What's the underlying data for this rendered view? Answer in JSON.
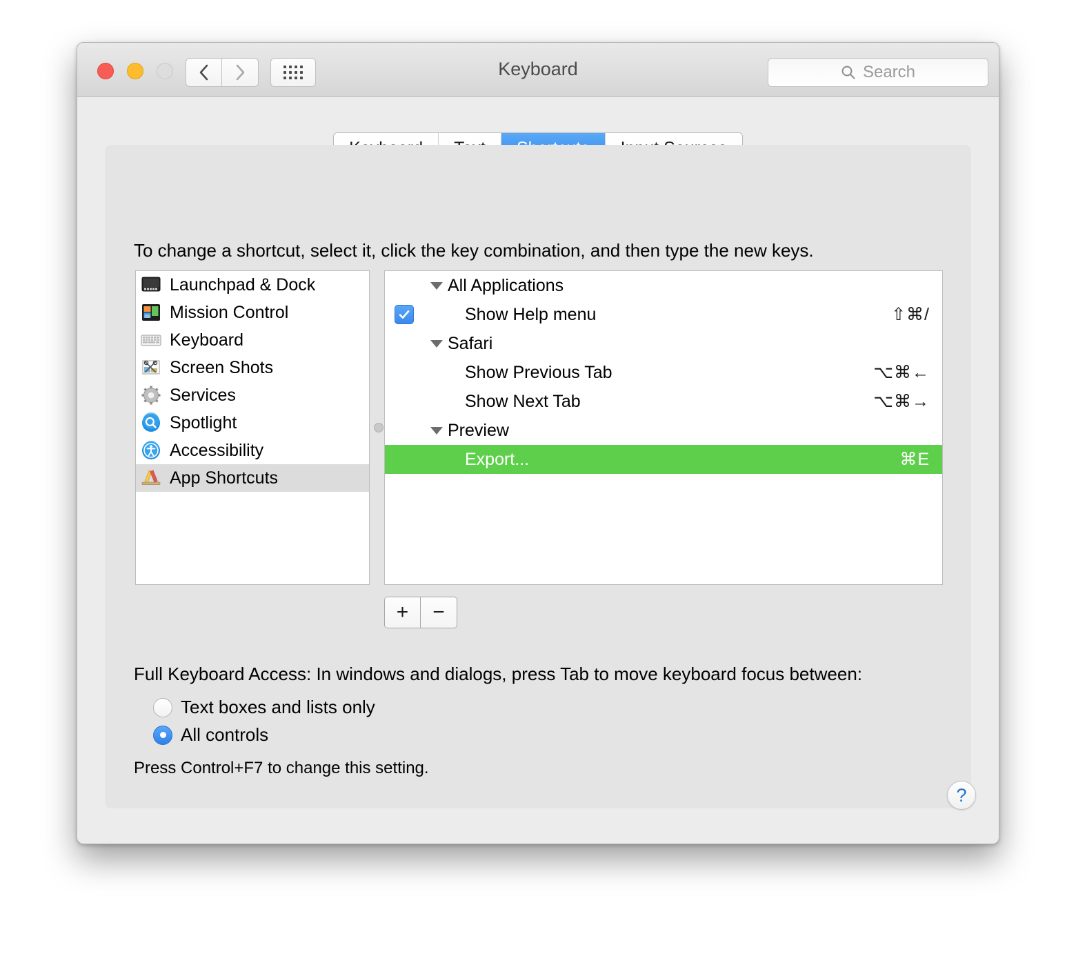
{
  "window": {
    "title": "Keyboard",
    "traffic_lights": [
      "close",
      "minimize",
      "zoom"
    ],
    "nav": {
      "back": "back-chevron",
      "forward": "forward-chevron",
      "grid": "show-all-grid"
    },
    "search": {
      "placeholder": "Search",
      "icon": "search-icon"
    }
  },
  "tabs": [
    {
      "label": "Keyboard",
      "active": false
    },
    {
      "label": "Text",
      "active": false
    },
    {
      "label": "Shortcuts",
      "active": true
    },
    {
      "label": "Input Sources",
      "active": false
    }
  ],
  "instruction": "To change a shortcut, select it, click the key combination, and then type the new keys.",
  "sidebar": {
    "items": [
      {
        "label": "Launchpad & Dock",
        "icon": "launchpad-dock-icon",
        "selected": false
      },
      {
        "label": "Mission Control",
        "icon": "mission-control-icon",
        "selected": false
      },
      {
        "label": "Keyboard",
        "icon": "keyboard-icon",
        "selected": false
      },
      {
        "label": "Screen Shots",
        "icon": "screenshots-icon",
        "selected": false
      },
      {
        "label": "Services",
        "icon": "services-gear-icon",
        "selected": false
      },
      {
        "label": "Spotlight",
        "icon": "spotlight-icon",
        "selected": false
      },
      {
        "label": "Accessibility",
        "icon": "accessibility-icon",
        "selected": false
      },
      {
        "label": "App Shortcuts",
        "icon": "app-shortcuts-icon",
        "selected": true
      }
    ]
  },
  "shortcuts_tree": [
    {
      "type": "group",
      "label": "All Applications",
      "expanded": true
    },
    {
      "type": "item",
      "label": "Show Help menu",
      "key": "⇧⌘/",
      "checked": true,
      "selected": false
    },
    {
      "type": "group",
      "label": "Safari",
      "expanded": true
    },
    {
      "type": "item",
      "label": "Show Previous Tab",
      "key": "⌥⌘←",
      "checked": false,
      "selected": false
    },
    {
      "type": "item",
      "label": "Show Next Tab",
      "key": "⌥⌘→",
      "checked": false,
      "selected": false
    },
    {
      "type": "group",
      "label": "Preview",
      "expanded": true
    },
    {
      "type": "item",
      "label": "Export...",
      "key": "⌘E",
      "checked": false,
      "selected": true
    }
  ],
  "list_buttons": {
    "add": "+",
    "remove": "−"
  },
  "full_keyboard_access": {
    "title": "Full Keyboard Access: In windows and dialogs, press Tab to move keyboard focus between:",
    "options": [
      {
        "label": "Text boxes and lists only",
        "selected": false
      },
      {
        "label": "All controls",
        "selected": true
      }
    ],
    "note": "Press Control+F7 to change this setting."
  },
  "help": {
    "label": "?"
  },
  "colors": {
    "accent_blue": "#3b88ec",
    "selection_green": "#5ecf4b",
    "sidebar_selection": "#dcdcdc",
    "window_bg": "#ececec",
    "panel_bg": "#e4e4e4"
  }
}
